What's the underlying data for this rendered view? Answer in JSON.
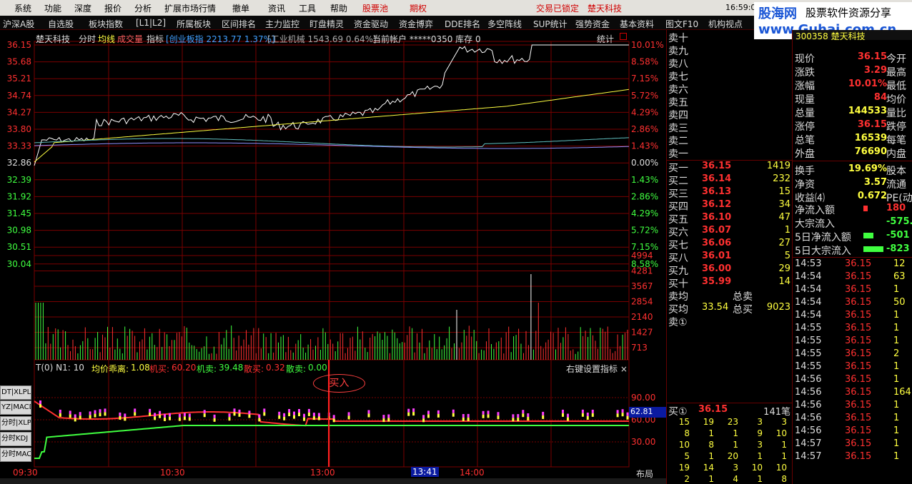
{
  "menubar": {
    "items": [
      "系统",
      "功能",
      "深度",
      "报价",
      "分析",
      "扩展市场行情",
      "撤单",
      "资讯",
      "工具",
      "帮助"
    ],
    "stock_pool": "股票池",
    "futures": "期权",
    "lock_status": "交易已锁定",
    "stock_name": "楚天科技",
    "clock": "16:59:0"
  },
  "logo": {
    "brand": "股海网",
    "slogan": "股票软件资源分享",
    "url": "www.Guhai.com.cn"
  },
  "tabs": [
    "沪深A股",
    "自选股",
    "板块指数",
    "[L1|L2]",
    "所属板块",
    "区间排名",
    "主力监控",
    "盯盘精灵",
    "资金驱动",
    "资金博弈",
    "DDE排名",
    "多空阵线",
    "SUP统计",
    "强势资金",
    "基本资料",
    "图文F10",
    "机构视点"
  ],
  "chart_header": {
    "name": "楚天科技",
    "labels": [
      "分时",
      "均线",
      "成交量",
      "指标"
    ],
    "index1": "[创业板指 2213.77 1.37%]",
    "index2": "[工业机械 1543.69 0.64%]",
    "account": "当前帐户 *****0350 库存 0",
    "stat_label": "统计"
  },
  "price_axis": {
    "left": [
      "36.15",
      "35.68",
      "35.21",
      "34.74",
      "34.27",
      "33.80",
      "33.33",
      "32.86",
      "32.39",
      "31.92",
      "31.45",
      "30.98",
      "30.51",
      "30.04"
    ],
    "right": [
      "10.01%",
      "8.58%",
      "7.15%",
      "5.72%",
      "4.29%",
      "2.86%",
      "1.43%",
      "0.00%",
      "1.43%",
      "2.86%",
      "4.29%",
      "5.72%",
      "7.15%",
      "8.58%"
    ]
  },
  "volume_axis": [
    "4994",
    "4281",
    "3567",
    "2854",
    "2140",
    "1427",
    "713"
  ],
  "indicator": {
    "title": "T(0)  N1: 10",
    "items": [
      {
        "label": "均价乖离:",
        "value": "1.08",
        "color": "#ffff40"
      },
      {
        "label": "机买:",
        "value": "60.20",
        "color": "#ff3030"
      },
      {
        "label": "机卖:",
        "value": "39.48",
        "color": "#40ff40"
      },
      {
        "label": "散买:",
        "value": "0.32",
        "color": "#ff3030"
      },
      {
        "label": "散卖:",
        "value": "0.00",
        "color": "#40ff40"
      }
    ],
    "settings": "右键设置指标 ×",
    "axis": [
      "90.00",
      "60.00",
      "30.00"
    ],
    "current": "62.81",
    "buy_marker": "买入"
  },
  "time_axis": [
    "09:30",
    "10:30",
    "13:00",
    "13:41",
    "14:00"
  ],
  "layout_label": "布局",
  "side_buttons": [
    "DT|XLPL",
    "YZ|MACD",
    "分时|XLPL",
    "分时KDJ",
    "分时MACD"
  ],
  "orderbook": {
    "sells": [
      "卖十",
      "卖九",
      "卖八",
      "卖七",
      "卖六",
      "卖五",
      "卖四",
      "卖三",
      "卖二",
      "卖一"
    ],
    "buys": [
      {
        "label": "买一",
        "price": "36.15",
        "vol": "1419"
      },
      {
        "label": "买二",
        "price": "36.14",
        "vol": "232"
      },
      {
        "label": "买三",
        "price": "36.13",
        "vol": "15"
      },
      {
        "label": "买四",
        "price": "36.12",
        "vol": "34"
      },
      {
        "label": "买五",
        "price": "36.10",
        "vol": "47"
      },
      {
        "label": "买六",
        "price": "36.07",
        "vol": "1"
      },
      {
        "label": "买七",
        "price": "36.06",
        "vol": "27"
      },
      {
        "label": "买八",
        "price": "36.01",
        "vol": "5"
      },
      {
        "label": "买九",
        "price": "36.00",
        "vol": "29"
      },
      {
        "label": "买十",
        "price": "35.99",
        "vol": "14"
      }
    ],
    "sell_avg_label": "卖均",
    "total_sell_label": "总卖",
    "buy_avg_label": "买均",
    "buy_avg": "33.54",
    "total_buy_label": "总买",
    "total_buy": "9023",
    "sell_one_circle": "卖①",
    "buy_one_circle": "买①",
    "buy_one_price": "36.15",
    "buy_one_pen": "141笔",
    "queue": [
      [
        "15",
        "19",
        "23",
        "3",
        "3"
      ],
      [
        "8",
        "1",
        "1",
        "9",
        "10"
      ],
      [
        "10",
        "8",
        "1",
        "3",
        "1"
      ],
      [
        "5",
        "1",
        "20",
        "1",
        "1"
      ],
      [
        "19",
        "14",
        "3",
        "10",
        "10"
      ],
      [
        "2",
        "1",
        "4",
        "1",
        "8"
      ]
    ]
  },
  "stats": {
    "code_partial": "300358 楚天科技",
    "rows": [
      {
        "l": "现价",
        "v": "36.15",
        "l2": "今开"
      },
      {
        "l": "涨跌",
        "v": "3.29",
        "l2": "最高"
      },
      {
        "l": "涨幅",
        "v": "10.01%",
        "l2": "最低"
      },
      {
        "l": "现量",
        "v": "84",
        "l2": "均价"
      },
      {
        "l": "总量",
        "v": "144533",
        "l2": "量比"
      },
      {
        "l": "涨停",
        "v": "36.15",
        "l2": "跌停"
      },
      {
        "l": "总笔",
        "v": "16539",
        "l2": "每笔"
      },
      {
        "l": "外盘",
        "v": "76690",
        "l2": "内盘"
      },
      {
        "l": "换手",
        "v": "19.69%",
        "l2": "股本"
      },
      {
        "l": "净资",
        "v": "3.57",
        "l2": "流通"
      },
      {
        "l": "收益⑷",
        "v": "0.672",
        "l2": "PE(动)"
      }
    ],
    "flows": [
      {
        "l": "净流入额",
        "v": "180",
        "bar": 6,
        "color": "#ff3030"
      },
      {
        "l": "大宗流入",
        "v": "-575.",
        "bar": 0,
        "color": "#40ff40"
      },
      {
        "l": "5日净流入额",
        "v": "-501",
        "bar": 14,
        "color": "#40ff40"
      },
      {
        "l": "5日大宗流入",
        "v": "-823",
        "bar": 28,
        "color": "#40ff40"
      }
    ],
    "ticks": [
      [
        "14:53",
        "36.15",
        "12"
      ],
      [
        "14:54",
        "36.15",
        "63"
      ],
      [
        "14:54",
        "36.15",
        "1"
      ],
      [
        "14:54",
        "36.15",
        "50"
      ],
      [
        "14:54",
        "36.15",
        "1"
      ],
      [
        "14:55",
        "36.15",
        "1"
      ],
      [
        "14:55",
        "36.15",
        "1"
      ],
      [
        "14:55",
        "36.15",
        "2"
      ],
      [
        "14:55",
        "36.15",
        "1"
      ],
      [
        "14:56",
        "36.15",
        "1"
      ],
      [
        "14:56",
        "36.15",
        "164"
      ],
      [
        "14:56",
        "36.15",
        "1"
      ],
      [
        "14:56",
        "36.15",
        "1"
      ],
      [
        "14:56",
        "36.15",
        "1"
      ],
      [
        "14:57",
        "36.15",
        "1"
      ],
      [
        "14:57",
        "36.15",
        "1"
      ]
    ]
  },
  "colors": {
    "up": "#ff3030",
    "down": "#40ff40",
    "grid": "#7a0000",
    "price_line": "#ffffff",
    "avg_line": "#ffff40"
  }
}
